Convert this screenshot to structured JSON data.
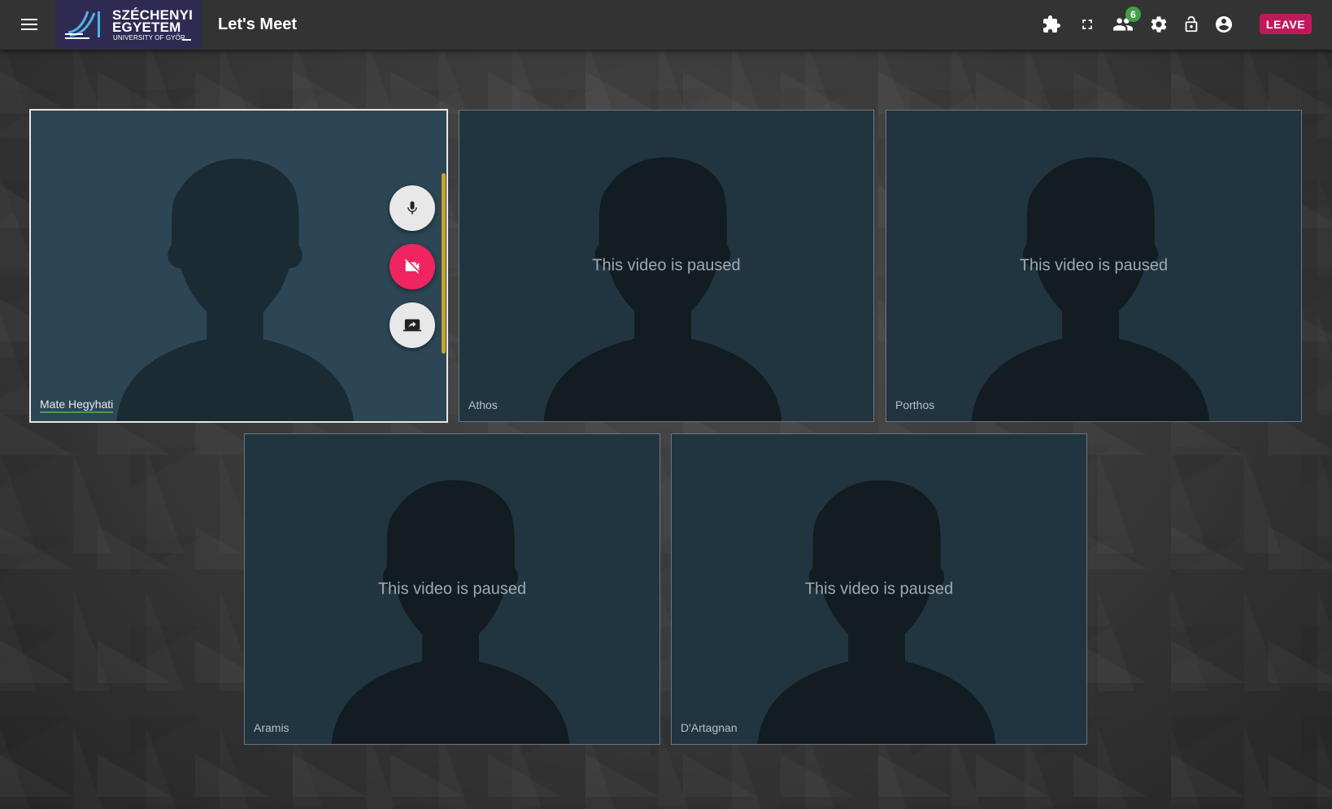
{
  "header": {
    "menu_icon": "hamburger-menu-icon",
    "logo": {
      "line1": "SZÉCHENYI",
      "line2": "EGYETEM",
      "line3": "UNIVERSITY OF GYŐR"
    },
    "title": "Let's Meet",
    "icons": [
      "puzzle-icon",
      "fullscreen-icon",
      "participants-icon",
      "gear-icon",
      "lock-open-icon",
      "account-icon"
    ],
    "participant_count": "6",
    "leave_label": "LEAVE"
  },
  "self_tile": {
    "name": "Mate Hegyhati",
    "controls": [
      "microphone-icon",
      "video-off-icon",
      "screen-share-icon"
    ]
  },
  "participants": [
    {
      "name": "Athos",
      "status": "This video is paused"
    },
    {
      "name": "Porthos",
      "status": "This video is paused"
    },
    {
      "name": "Aramis",
      "status": "This video is paused"
    },
    {
      "name": "D'Artagnan",
      "status": "This video is paused"
    }
  ],
  "colors": {
    "topbar": "#333333",
    "leave_button": "#c2185b",
    "badge": "#43a047",
    "video_off_button": "#f0245f",
    "control_bar": "#c9a227"
  }
}
